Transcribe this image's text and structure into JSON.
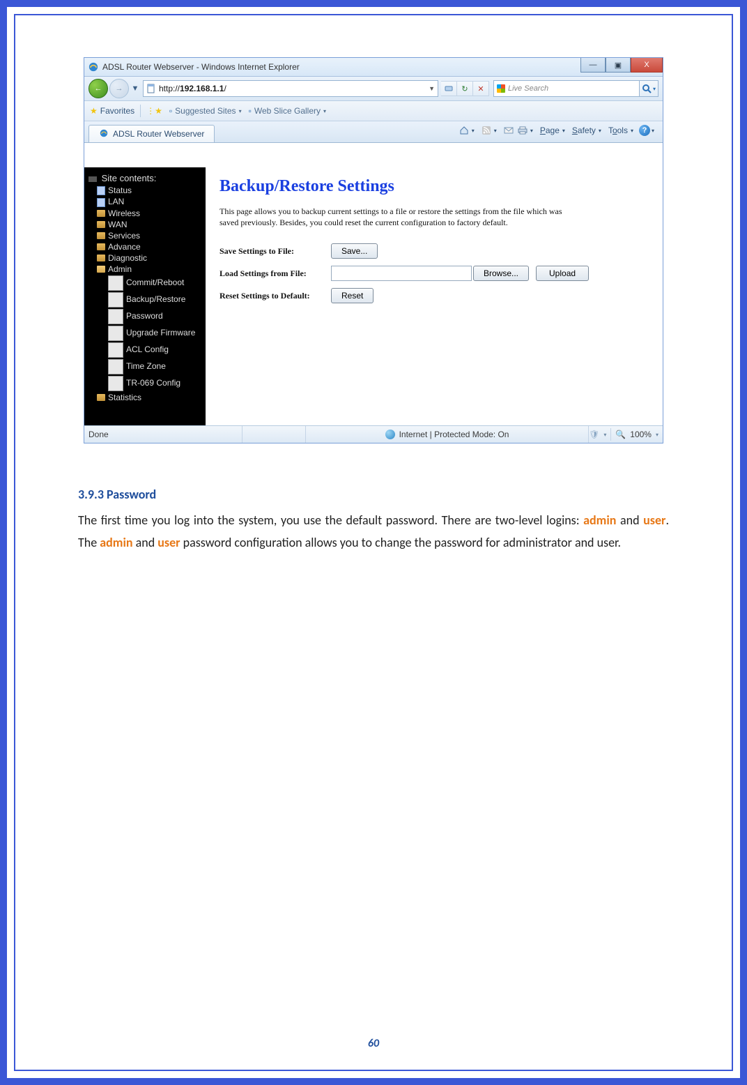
{
  "titlebar": {
    "text": "ADSL Router Webserver - Windows Internet Explorer"
  },
  "win_buttons": {
    "min": "—",
    "max": "▣",
    "close": "X"
  },
  "nav": {
    "back_arrow": "←",
    "fwd_arrow": "→"
  },
  "address": {
    "scheme": "http://",
    "host": "192.168.1.1",
    "rest": "/",
    "dropdown": "▼"
  },
  "addr_tools": {
    "refresh": "↻",
    "stop": "✕",
    "compat": "⇄"
  },
  "live_search": {
    "placeholder": "Live Search",
    "go": "🔍"
  },
  "favorites": {
    "label": "Favorites",
    "sites": "Suggested Sites",
    "gallery": "Web Slice Gallery"
  },
  "tab": {
    "label": "ADSL Router Webserver"
  },
  "commandbar": {
    "page": "Page",
    "safety": "Safety",
    "tools": "Tools"
  },
  "sidebar": {
    "root": "Site contents:",
    "items": [
      {
        "label": "Status",
        "cls": "page-b",
        "lvl": 1
      },
      {
        "label": "LAN",
        "cls": "page-b",
        "lvl": 1
      },
      {
        "label": "Wireless",
        "cls": "folder",
        "lvl": 1
      },
      {
        "label": "WAN",
        "cls": "folder",
        "lvl": 1
      },
      {
        "label": "Services",
        "cls": "folder",
        "lvl": 1
      },
      {
        "label": "Advance",
        "cls": "folder",
        "lvl": 1
      },
      {
        "label": "Diagnostic",
        "cls": "folder",
        "lvl": 1
      },
      {
        "label": "Admin",
        "cls": "folder-open",
        "lvl": 1
      },
      {
        "label": "Commit/Reboot",
        "cls": "page",
        "lvl": 2
      },
      {
        "label": "Backup/Restore",
        "cls": "page",
        "lvl": 2
      },
      {
        "label": "Password",
        "cls": "page",
        "lvl": 2
      },
      {
        "label": "Upgrade Firmware",
        "cls": "page",
        "lvl": 2
      },
      {
        "label": "ACL Config",
        "cls": "page",
        "lvl": 2
      },
      {
        "label": "Time Zone",
        "cls": "page",
        "lvl": 2
      },
      {
        "label": "TR-069 Config",
        "cls": "page",
        "lvl": 2
      },
      {
        "label": "Statistics",
        "cls": "folder",
        "lvl": 1
      }
    ]
  },
  "main": {
    "heading": "Backup/Restore Settings",
    "desc": "This page allows you to backup current settings to a file or restore the settings from the file which was saved previously. Besides, you could reset the current configuration to factory default.",
    "save_label": "Save Settings to File:",
    "save_btn": "Save...",
    "load_label": "Load Settings from File:",
    "browse_btn": "Browse...",
    "upload_btn": "Upload",
    "reset_label": "Reset Settings to Default:",
    "reset_btn": "Reset"
  },
  "status": {
    "done": "Done",
    "zone": "Internet | Protected Mode: On",
    "zoom": "100%"
  },
  "doc": {
    "heading": "3.9.3 Password",
    "p_a": "The first time you log into the system, you use the default password. There are two-level logins: ",
    "admin": "admin",
    "and": " and ",
    "user": "user",
    "p_b": ". The ",
    "p_c": " password configuration allows you to change the password for administrator and user."
  },
  "page_number": "60"
}
